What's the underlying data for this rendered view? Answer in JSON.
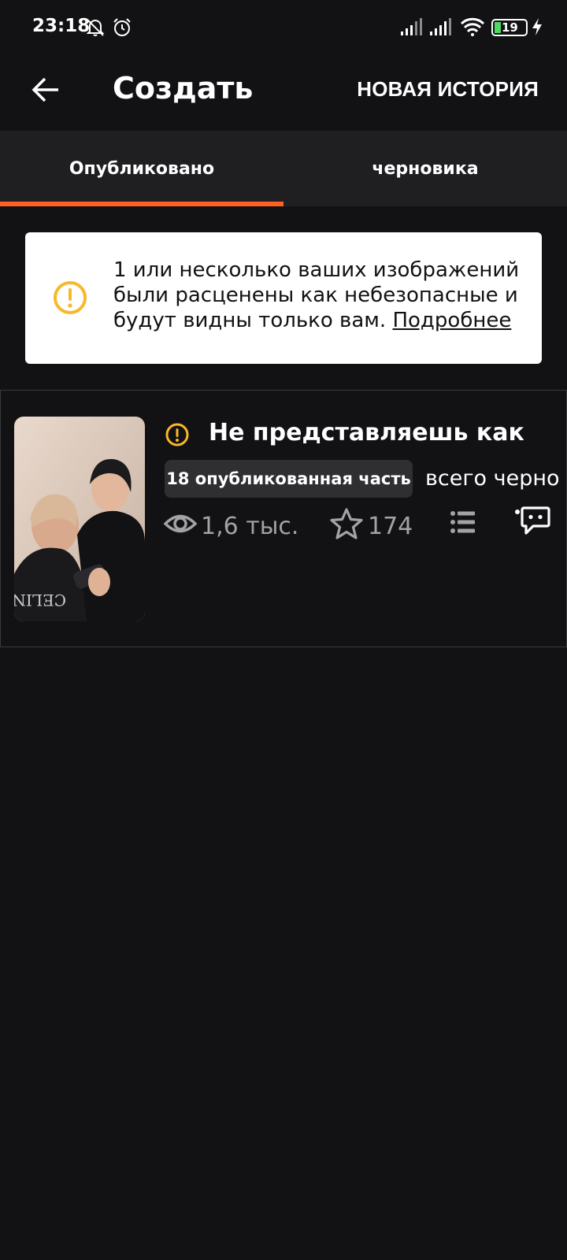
{
  "status_bar": {
    "time": "23:18",
    "battery_level": "19",
    "icons": [
      "notifications-muted-icon",
      "alarm-icon",
      "signal-icon",
      "signal-icon",
      "wifi-icon",
      "battery-icon",
      "charging-icon"
    ]
  },
  "app_bar": {
    "title": "Создать",
    "action_label": "НОВАЯ ИСТОРИЯ",
    "back_icon": "arrow-left-icon"
  },
  "tabs": [
    {
      "label": "Опубликовано",
      "active": true
    },
    {
      "label": "черновика",
      "active": false
    }
  ],
  "warning_banner": {
    "text": "1 или несколько ваших изображений были расценены как небезопасные и будут видны только вам.",
    "link_label": "Подробнее",
    "icon": "warning-icon"
  },
  "story": {
    "title": "Не представляешь как…",
    "parts_badge": "18 опубликованная часть",
    "drafts_text": "всего черно",
    "views": "1,6 тыс.",
    "votes": "174",
    "alert_icon": "warning-icon",
    "icons": [
      "eye-icon",
      "star-icon",
      "list-icon",
      "comment-icon"
    ]
  },
  "colors": {
    "background": "#121114",
    "tab_background": "#1f1e21",
    "accent": "#ff6122",
    "warning": "#f7b928",
    "muted_text": "#a3a2a6"
  }
}
